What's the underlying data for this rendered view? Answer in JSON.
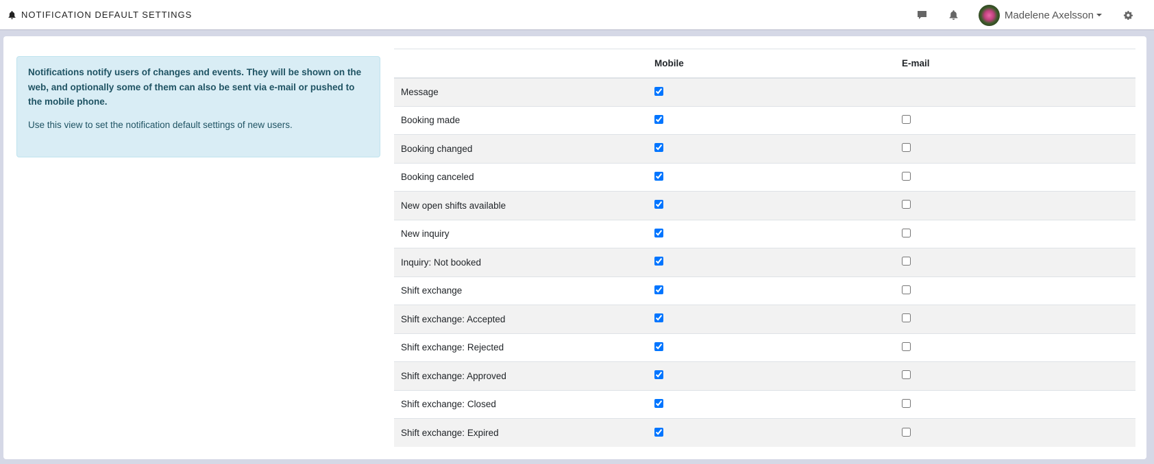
{
  "header": {
    "title": "NOTIFICATION DEFAULT SETTINGS",
    "user_name": "Madelene Axelsson"
  },
  "info": {
    "primary": "Notifications notify users of changes and events. They will be shown on the web, and optionally some of them can also be sent via e-mail or pushed to the mobile phone.",
    "secondary": "Use this view to set the notification default settings of new users."
  },
  "table": {
    "columns": [
      "",
      "Mobile",
      "E-mail"
    ],
    "rows": [
      {
        "label": "Message",
        "mobile": true,
        "email": null
      },
      {
        "label": "Booking made",
        "mobile": true,
        "email": false
      },
      {
        "label": "Booking changed",
        "mobile": true,
        "email": false
      },
      {
        "label": "Booking canceled",
        "mobile": true,
        "email": false
      },
      {
        "label": "New open shifts available",
        "mobile": true,
        "email": false
      },
      {
        "label": "New inquiry",
        "mobile": true,
        "email": false
      },
      {
        "label": "Inquiry: Not booked",
        "mobile": true,
        "email": false
      },
      {
        "label": "Shift exchange",
        "mobile": true,
        "email": false
      },
      {
        "label": "Shift exchange: Accepted",
        "mobile": true,
        "email": false
      },
      {
        "label": "Shift exchange: Rejected",
        "mobile": true,
        "email": false
      },
      {
        "label": "Shift exchange: Approved",
        "mobile": true,
        "email": false
      },
      {
        "label": "Shift exchange: Closed",
        "mobile": true,
        "email": false
      },
      {
        "label": "Shift exchange: Expired",
        "mobile": true,
        "email": false
      }
    ]
  }
}
